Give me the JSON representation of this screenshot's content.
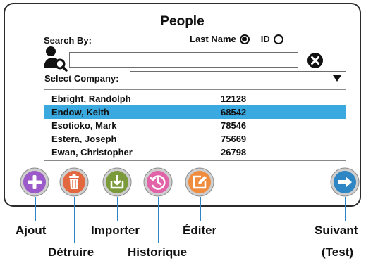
{
  "window": {
    "title": "People"
  },
  "search": {
    "label": "Search By:",
    "options": [
      {
        "label": "Last Name",
        "selected": true
      },
      {
        "label": "ID",
        "selected": false
      }
    ],
    "input_value": "",
    "company_label": "Select Company:",
    "company_value": ""
  },
  "people": [
    {
      "name": "Ebright, Randolph",
      "id": "12128",
      "selected": false
    },
    {
      "name": "Endow, Keith",
      "id": "68542",
      "selected": true
    },
    {
      "name": "Esotioko, Mark",
      "id": "78546",
      "selected": false
    },
    {
      "name": "Estera, Joseph",
      "id": "75669",
      "selected": false
    },
    {
      "name": "Ewan, Christopher",
      "id": "26798",
      "selected": false
    }
  ],
  "buttons": [
    {
      "key": "add",
      "icon": "plus-icon",
      "color": "#9b59c9",
      "label": "Ajout"
    },
    {
      "key": "delete",
      "icon": "trash-icon",
      "color": "#e2693f",
      "label": "Détruire"
    },
    {
      "key": "import",
      "icon": "import-icon",
      "color": "#7a9a3b",
      "label": "Importer"
    },
    {
      "key": "history",
      "icon": "history-icon",
      "color": "#e264a8",
      "label": "Historique"
    },
    {
      "key": "edit",
      "icon": "edit-icon",
      "color": "#ef8c3d",
      "label": "Éditer"
    },
    {
      "key": "next",
      "icon": "arrow-right-icon",
      "color": "#2f86c4",
      "label": "Suivant",
      "label2": "(Test)"
    }
  ],
  "colors": {
    "selected_row": "#3aa9e0",
    "callout": "#2f86c4"
  }
}
